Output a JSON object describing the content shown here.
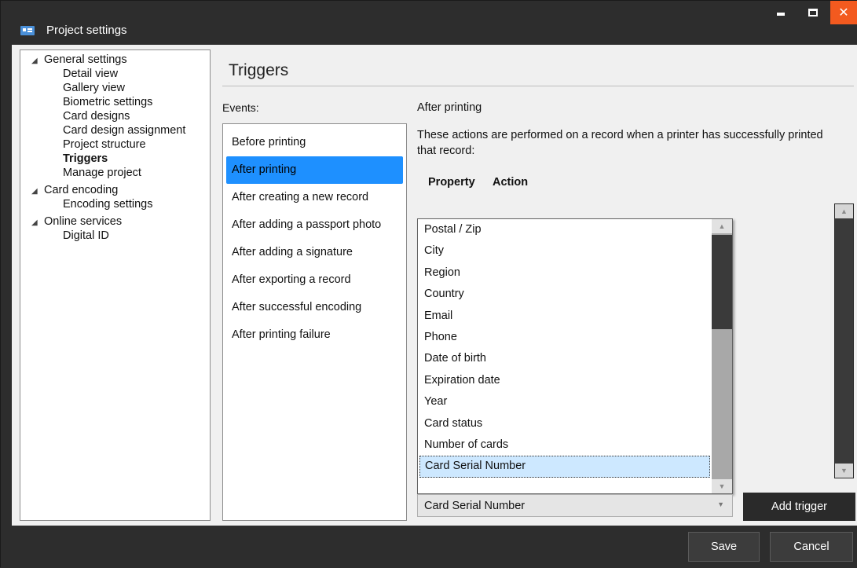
{
  "window": {
    "title": "Project settings",
    "icon": "id-card-icon"
  },
  "tree": {
    "items": [
      {
        "label": "General settings",
        "level": 0,
        "expanded": true
      },
      {
        "label": "Detail view",
        "level": 1
      },
      {
        "label": "Gallery view",
        "level": 1
      },
      {
        "label": "Biometric settings",
        "level": 1
      },
      {
        "label": "Card designs",
        "level": 1
      },
      {
        "label": "Card design assignment",
        "level": 1
      },
      {
        "label": "Project structure",
        "level": 1
      },
      {
        "label": "Triggers",
        "level": 1,
        "selected": true
      },
      {
        "label": "Manage project",
        "level": 1
      },
      {
        "label": "Card encoding",
        "level": 0,
        "expanded": true
      },
      {
        "label": "Encoding settings",
        "level": 1
      },
      {
        "label": "Online services",
        "level": 0,
        "expanded": true
      },
      {
        "label": "Digital ID",
        "level": 1
      }
    ],
    "expand_glyph": "◢"
  },
  "main": {
    "title": "Triggers",
    "events_label": "Events:",
    "events": [
      "Before printing",
      "After printing",
      "After creating a new record",
      "After adding a passport photo",
      "After adding a signature",
      "After exporting a record",
      "After successful encoding",
      "After printing failure"
    ],
    "selected_event": "After printing",
    "detail": {
      "title": "After printing",
      "description": "These actions are performed on a record when a printer has successfully printed that record:",
      "col_property": "Property",
      "col_action": "Action"
    },
    "property_options": [
      "Postal / Zip",
      "City",
      "Region",
      "Country",
      "Email",
      "Phone",
      "Date of birth",
      "Expiration date",
      "Year",
      "Card status",
      "Number of cards",
      "Card Serial Number"
    ],
    "property_selected": "Card Serial Number",
    "add_trigger_label": "Add trigger"
  },
  "footer": {
    "save_label": "Save",
    "cancel_label": "Cancel"
  },
  "colors": {
    "accent": "#1e90ff",
    "close": "#f35a1f",
    "highlight": "#cde8ff"
  }
}
